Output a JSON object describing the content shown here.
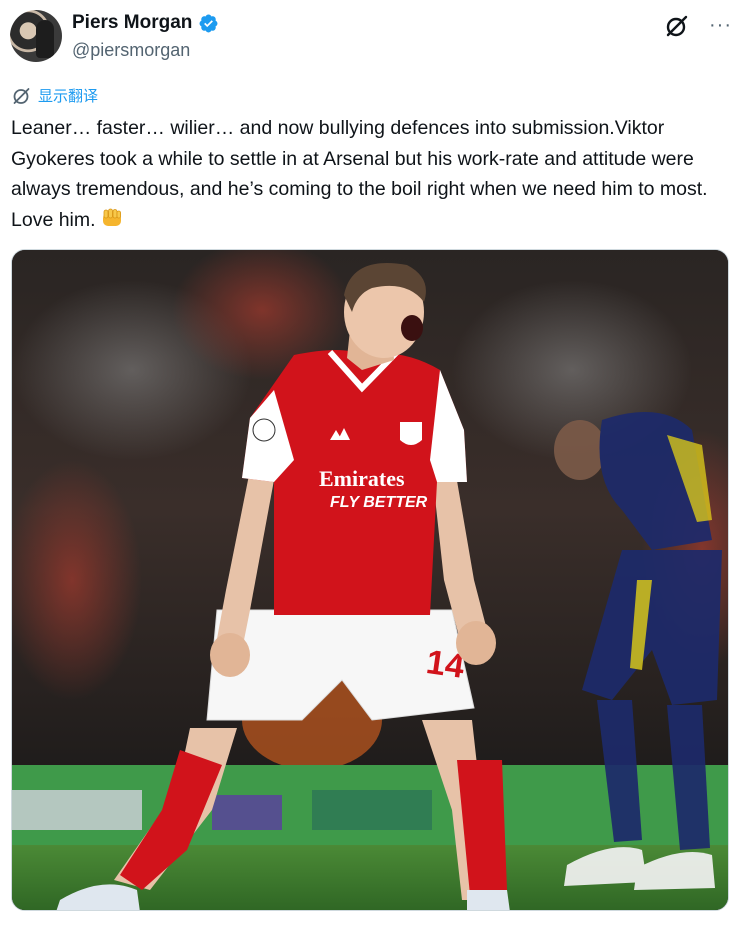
{
  "author": {
    "display_name": "Piers Morgan",
    "handle": "@piersmorgan",
    "verified": true,
    "avatar_icon": "avatar-photo"
  },
  "actions": {
    "grok_icon": "grok-icon",
    "more_icon": "more-options-icon",
    "more_label": "···"
  },
  "translate": {
    "label": "显示翻译",
    "icon": "translate-icon"
  },
  "tweet": {
    "text": "Leaner… faster… wilier… and now bullying defences into submission.Viktor Gyokeres took a while to settle in at Arsenal but his work-rate and attitude were always tremendous, and he’s coming to the boil right when we need him to most. Love him.",
    "emoji": "fist-icon"
  },
  "media": {
    "type": "photo",
    "shirt_sponsor_line1": "Emirates",
    "shirt_sponsor_line2": "FLY BETTER",
    "shorts_number": "14",
    "colors": {
      "arsenal_red": "#d1131b",
      "white": "#ffffff",
      "pitch_green": "#3f7a2e",
      "opponent_navy": "#1d2a6b",
      "opponent_yellow": "#e4d31a"
    }
  },
  "colors": {
    "verified_blue": "#1d9bf0",
    "text_primary": "#0f1419",
    "text_secondary": "#536471",
    "link_blue": "#1d9bf0"
  }
}
